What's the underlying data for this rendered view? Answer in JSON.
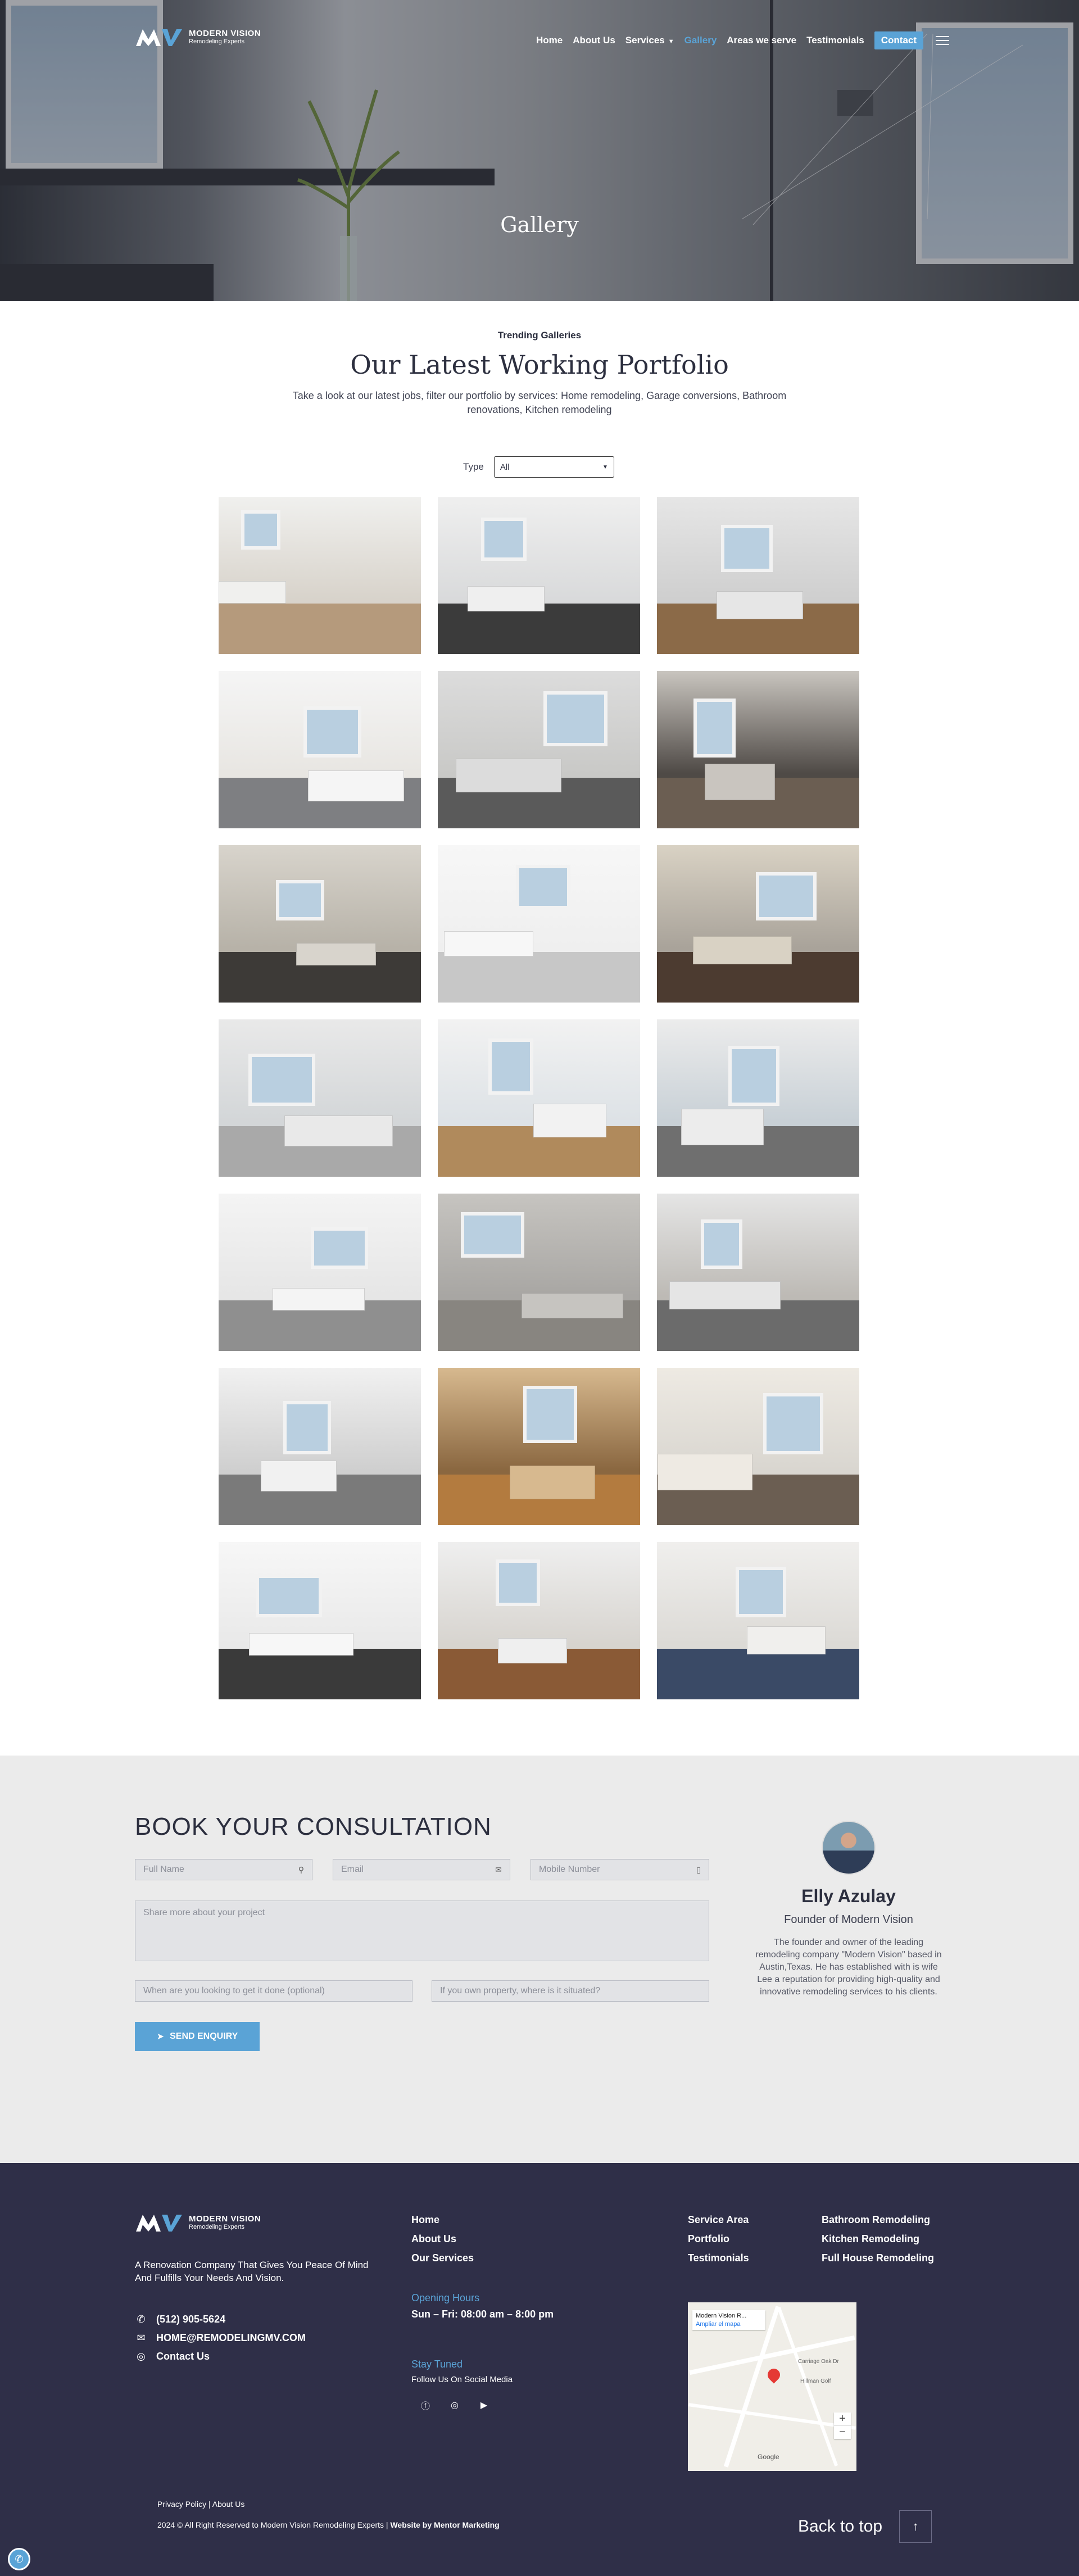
{
  "brand": {
    "name": "MODERN VISION",
    "tagline": "Remodeling Experts"
  },
  "nav": {
    "items": [
      "Home",
      "About Us",
      "Services",
      "Gallery",
      "Areas we serve",
      "Testimonials"
    ],
    "active": "Gallery",
    "contact_label": "Contact"
  },
  "hero": {
    "title": "Gallery"
  },
  "portfolio": {
    "eyebrow": "Trending Galleries",
    "heading": "Our Latest Working Portfolio",
    "intro": "Take a look at our latest jobs, filter our portfolio by services: Home remodeling, Garage conversions, Bathroom renovations, Kitchen remodeling",
    "filter_label": "Type",
    "filter_value": "All"
  },
  "gallery_images": [
    {
      "icon": "bathroom-tub-photo"
    },
    {
      "icon": "kitchen-island-photo"
    },
    {
      "icon": "kitchen-photo"
    },
    {
      "icon": "open-kitchen-photo"
    },
    {
      "icon": "kitchen-fridge-photo"
    },
    {
      "icon": "living-fireplace-photo"
    },
    {
      "icon": "living-room-photo"
    },
    {
      "icon": "shower-tile-photo"
    },
    {
      "icon": "bathroom-tub-photo"
    },
    {
      "icon": "shower-glass-photo"
    },
    {
      "icon": "hallway-vanity-photo"
    },
    {
      "icon": "shower-window-photo"
    },
    {
      "icon": "shower-marble-photo"
    },
    {
      "icon": "walk-in-shower-photo"
    },
    {
      "icon": "bathroom-vanity-photo"
    },
    {
      "icon": "vanity-marble-photo"
    },
    {
      "icon": "wood-kitchen-photo"
    },
    {
      "icon": "kitchen-chandelier-photo"
    },
    {
      "icon": "white-kitchen-photo"
    },
    {
      "icon": "kitchen-counter-photo"
    },
    {
      "icon": "kitchen-island-photo"
    }
  ],
  "consultation": {
    "heading": "BOOK YOUR CONSULTATION",
    "full_name_placeholder": "Full Name",
    "email_placeholder": "Email",
    "mobile_placeholder": "Mobile Number",
    "project_placeholder": "Share more about your project",
    "when_placeholder": "When are you looking to get it done (optional)",
    "property_placeholder": "If you own property, where is it situated?",
    "send_label": "SEND ENQUIRY",
    "founder_name": "Elly Azulay",
    "founder_title": "Founder of Modern Vision",
    "founder_desc": "The founder and owner of the leading remodeling company \"Modern Vision\" based in Austin,Texas. He has established with is wife Lee a reputation for providing high-quality and innovative remodeling services to his clients."
  },
  "footer": {
    "tagline": "A Renovation Company That Gives You Peace Of Mind And Fulfills Your Needs And Vision.",
    "phone": "(512) 905-5624",
    "email": "HOME@REMODELINGMV.COM",
    "contact_label": "Contact Us",
    "col1": [
      "Home",
      "About Us",
      "Our Services"
    ],
    "hours_heading": "Opening Hours",
    "hours": "Sun – Fri: 08:00 am – 8:00 pm",
    "social_heading": "Stay Tuned",
    "social_sub": "Follow Us On Social Media",
    "col2": [
      "Service Area",
      "Portfolio",
      "Testimonials"
    ],
    "col3": [
      "Bathroom Remodeling",
      "Kitchen Remodeling",
      "Full House Remodeling"
    ],
    "map_place": "Modern Vision R...",
    "map_link": "Ampliar el mapa",
    "map_label_1": "Carriage Oak Dr",
    "map_label_2": "Hillman Golf",
    "map_label_3": "Google",
    "bottom_links": "Privacy Policy | About Us",
    "copyright": "2024 © All Right Reserved to Modern Vision Remodeling Experts |",
    "credit": "Website by Mentor Marketing",
    "back_to_top": "Back to top"
  }
}
